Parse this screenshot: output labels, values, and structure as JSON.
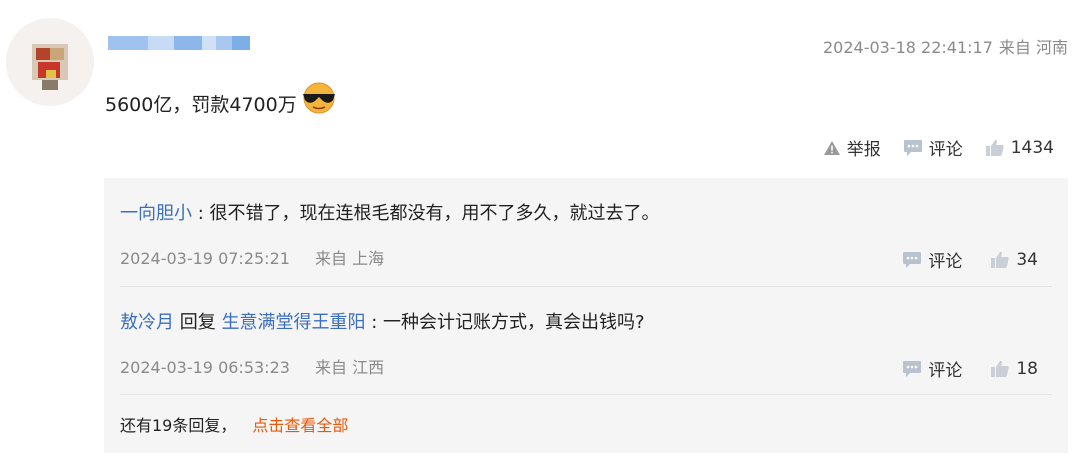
{
  "comment": {
    "text": "5600亿，罚款4700万",
    "emoji_icon": "sunglasses-emoji-icon",
    "timestamp": "2024-03-18 22:41:17",
    "location": "来自 河南",
    "report_label": "举报",
    "comment_label": "评论",
    "like_count": "1434"
  },
  "replies": [
    {
      "author": "一向胆小",
      "separator": ":",
      "text": "很不错了，现在连根毛都没有，用不了多久，就过去了。",
      "timestamp": "2024-03-19 07:25:21",
      "location": "来自 上海",
      "comment_label": "评论",
      "like_count": "34"
    },
    {
      "author": "敖冷月",
      "reply_word": "回复",
      "reply_to": "生意满堂得王重阳",
      "separator": ":",
      "text": "一种会计记账方式，真会出钱吗?",
      "timestamp": "2024-03-19 06:53:23",
      "location": "来自 江西",
      "comment_label": "评论",
      "like_count": "18"
    }
  ],
  "more": {
    "count_text": "还有19条回复，",
    "link_text": "点击查看全部"
  },
  "colors": {
    "link_blue": "#3a6fc0",
    "accent_orange": "#e8590c",
    "meta_gray": "#8a8a8a",
    "reply_bg": "#f5f5f5"
  }
}
